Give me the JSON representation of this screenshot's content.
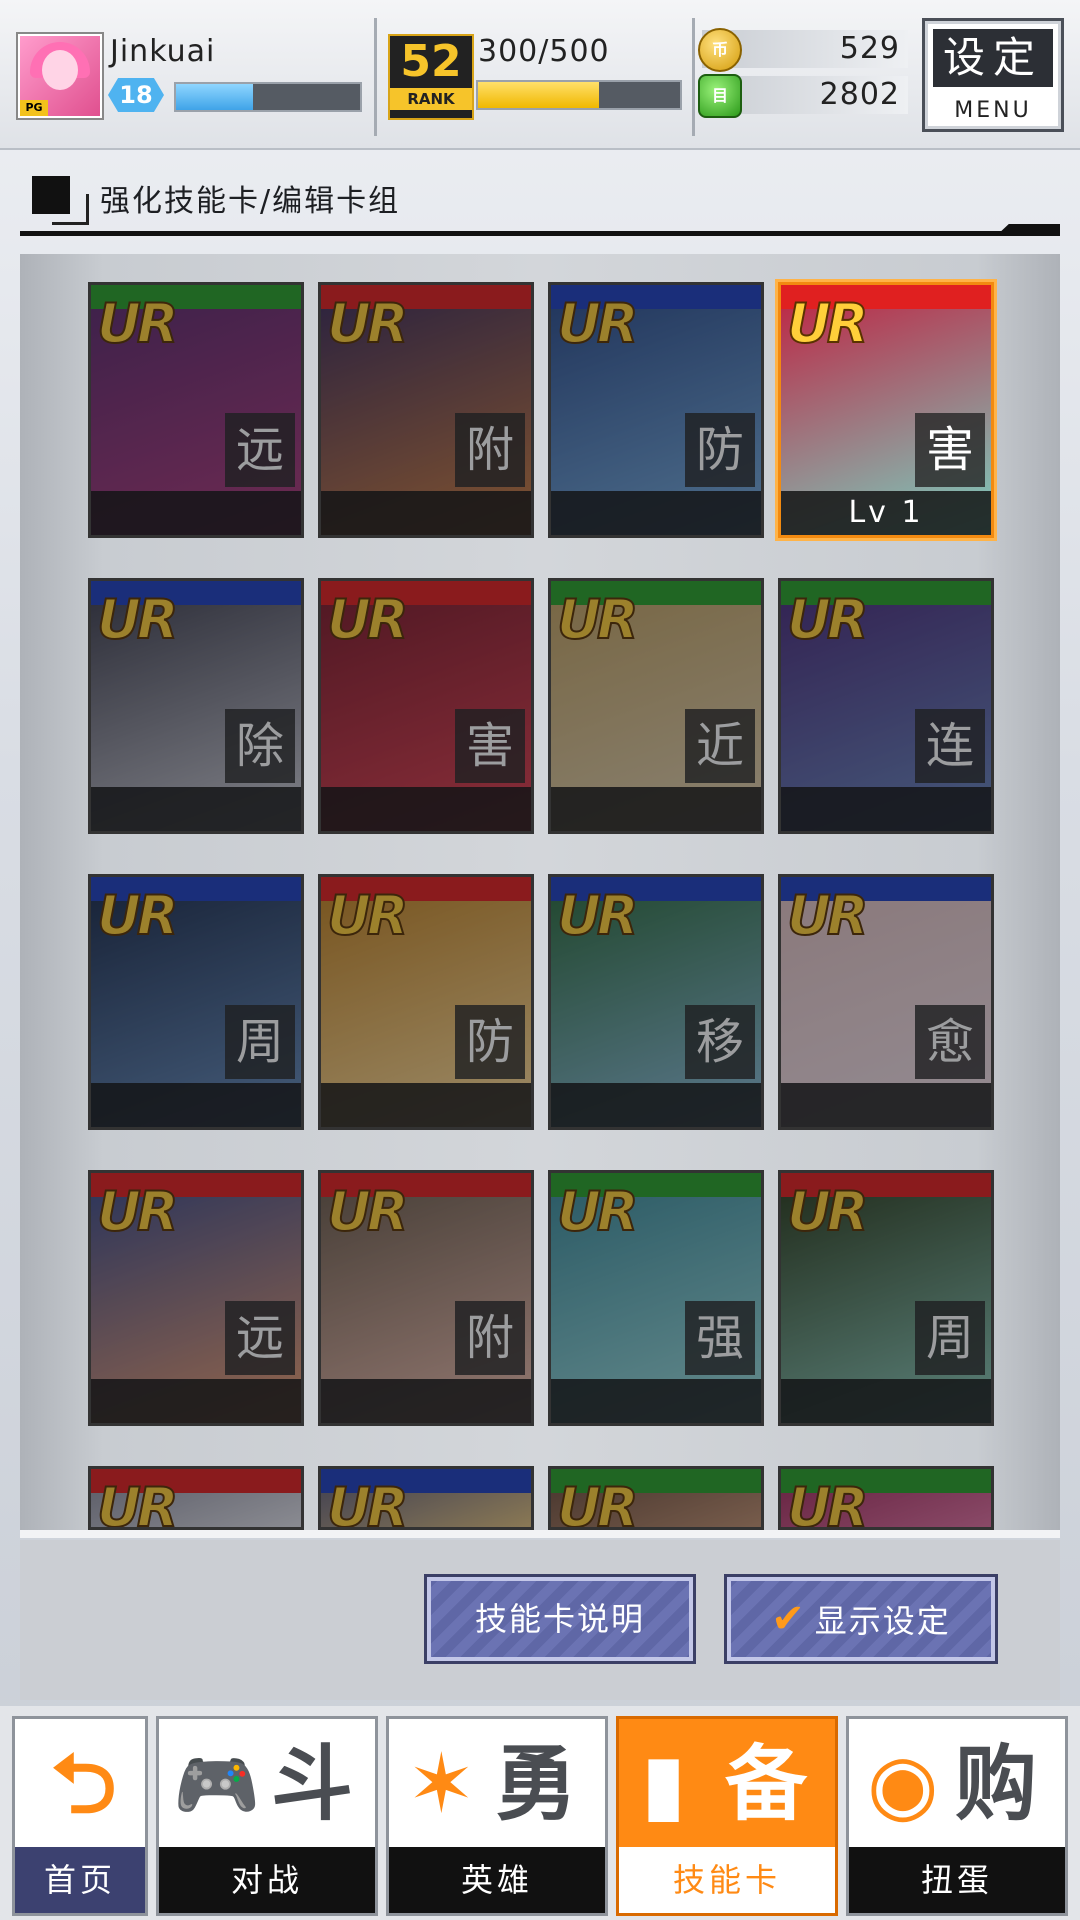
{
  "player": {
    "name": "Jinkuai",
    "level": "18",
    "exp_progress": 0.42
  },
  "rank": {
    "number": "52",
    "word": "RANK",
    "progress_text": "300/500",
    "progress": 0.6
  },
  "currency": {
    "coins": "529",
    "gems": "2802",
    "coin_glyph": "币",
    "gem_glyph": "目"
  },
  "menu": {
    "label_cn": "设定",
    "label_en": "MENU"
  },
  "section": {
    "title": "强化技能卡/编辑卡组"
  },
  "cards": [
    {
      "rarity": "UR",
      "type": "远",
      "color": "#2aa02a",
      "art": [
        "#5a2a6e",
        "#b03a7a"
      ]
    },
    {
      "rarity": "UR",
      "type": "附",
      "color": "#e02020",
      "art": [
        "#3a2a5a",
        "#d08040"
      ]
    },
    {
      "rarity": "UR",
      "type": "防",
      "color": "#2040c0",
      "art": [
        "#2a4a8a",
        "#7ab0e0"
      ]
    },
    {
      "rarity": "UR",
      "type": "害",
      "color": "#e02020",
      "art": [
        "#c02040",
        "#7ad0c0"
      ],
      "level": "Lv 1",
      "active": true
    },
    {
      "rarity": "UR",
      "type": "除",
      "color": "#2040c0",
      "art": [
        "#3a3a4a",
        "#d0d0d8"
      ]
    },
    {
      "rarity": "UR",
      "type": "害",
      "color": "#e02020",
      "art": [
        "#7a1a2a",
        "#e04050"
      ]
    },
    {
      "rarity": "UR",
      "type": "近",
      "color": "#2aa02a",
      "art": [
        "#c0a060",
        "#e0d0b0"
      ]
    },
    {
      "rarity": "UR",
      "type": "连",
      "color": "#2aa02a",
      "art": [
        "#4a2a7a",
        "#6a8ac0"
      ]
    },
    {
      "rarity": "UR",
      "type": "周",
      "color": "#2040c0",
      "art": [
        "#1a2a4a",
        "#6a90c0"
      ]
    },
    {
      "rarity": "UR",
      "type": "防",
      "color": "#e02020",
      "art": [
        "#c08020",
        "#ffe0a0"
      ]
    },
    {
      "rarity": "UR",
      "type": "移",
      "color": "#2040c0",
      "art": [
        "#2a6a3a",
        "#90c0e0"
      ]
    },
    {
      "rarity": "UR",
      "type": "愈",
      "color": "#2040c0",
      "art": [
        "#e0c0c0",
        "#f0e0e8"
      ]
    },
    {
      "rarity": "UR",
      "type": "远",
      "color": "#e02020",
      "art": [
        "#3a4a8a",
        "#f0a070"
      ]
    },
    {
      "rarity": "UR",
      "type": "附",
      "color": "#e02020",
      "art": [
        "#6a5a4a",
        "#f0c0b0"
      ]
    },
    {
      "rarity": "UR",
      "type": "强",
      "color": "#2aa02a",
      "art": [
        "#3a8a9a",
        "#a0e0e0"
      ]
    },
    {
      "rarity": "UR",
      "type": "周",
      "color": "#e02020",
      "art": [
        "#2a3a1a",
        "#90d0c0"
      ]
    },
    {
      "rarity": "UR",
      "color": "#e02020",
      "art": [
        "#8a8a9a",
        "#e0e0e8"
      ]
    },
    {
      "rarity": "UR",
      "color": "#2040c0",
      "art": [
        "#5a5a7a",
        "#e0c080"
      ]
    },
    {
      "rarity": "UR",
      "color": "#2aa02a",
      "art": [
        "#6a4a3a",
        "#c09070"
      ]
    },
    {
      "rarity": "UR",
      "color": "#2aa02a",
      "art": [
        "#a02a5a",
        "#e070a0"
      ]
    }
  ],
  "actions": {
    "explain_label": "技能卡说明",
    "display_label": "显示设定",
    "check_glyph": "✔"
  },
  "nav": [
    {
      "label": "首页",
      "glyph": "⮌"
    },
    {
      "label": "对战",
      "glyph": "🎮",
      "text": "斗"
    },
    {
      "label": "英雄",
      "glyph": "✶",
      "text": "勇"
    },
    {
      "label": "技能卡",
      "glyph": "▮",
      "text": "备",
      "active": true
    },
    {
      "label": "扭蛋",
      "glyph": "◉",
      "text": "购"
    }
  ]
}
